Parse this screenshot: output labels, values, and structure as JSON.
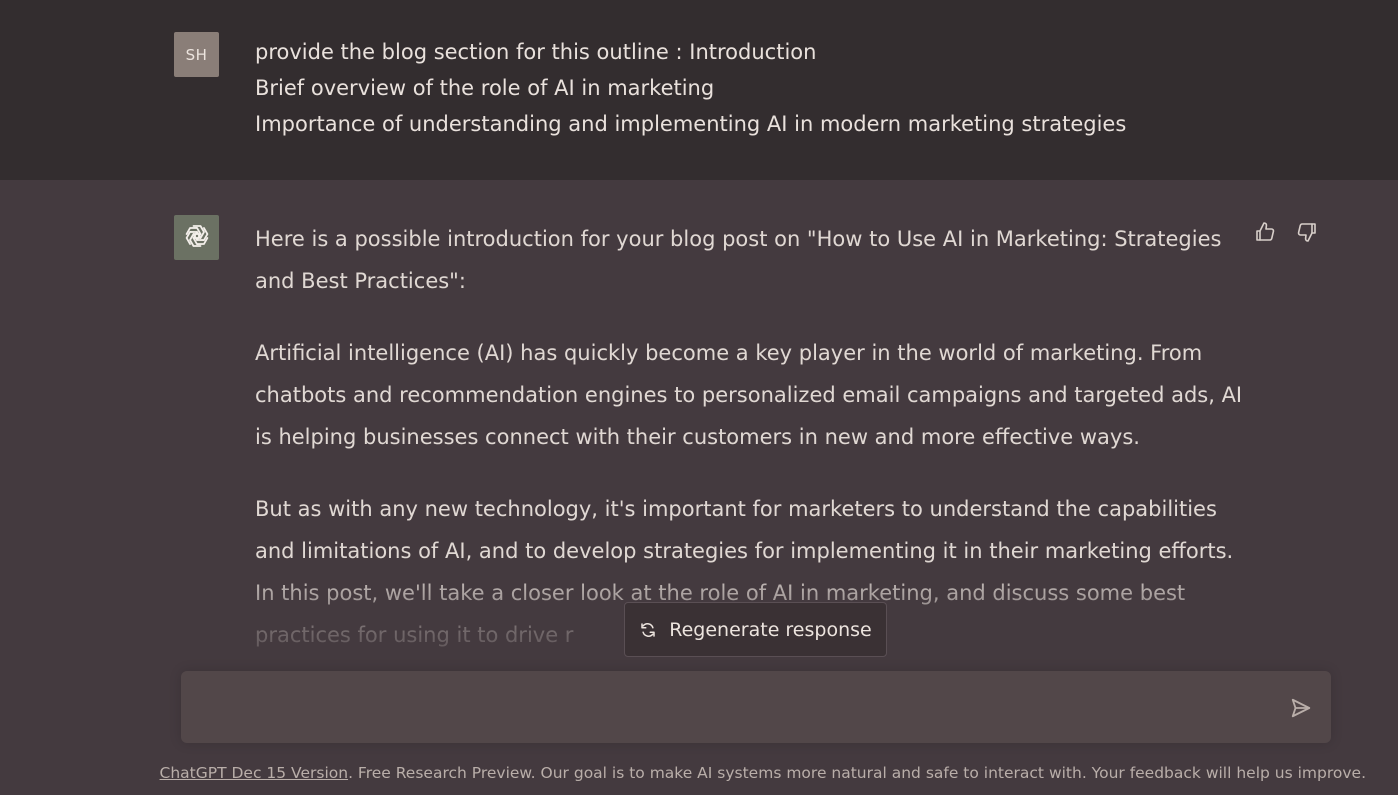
{
  "user_message": {
    "avatar_initials": "SH",
    "lines": [
      "provide the blog section for this outline : Introduction",
      "Brief overview of the role of AI in marketing",
      "Importance of understanding and implementing AI in modern marketing strategies"
    ]
  },
  "assistant_message": {
    "avatar_icon": "openai-logo-icon",
    "paragraphs": [
      "Here is a possible introduction for your blog post on \"How to Use AI in Marketing: Strategies and Best Practices\":",
      "Artificial intelligence (AI) has quickly become a key player in the world of marketing. From chatbots and recommendation engines to personalized email campaigns and targeted ads, AI is helping businesses connect with their customers in new and more effective ways.",
      "But as with any new technology, it's important for marketers to understand the capabilities and limitations of AI, and to develop strategies for implementing it in their marketing efforts. In this post, we'll take a closer look at the role of AI in marketing, and discuss some best practices for using it to drive r"
    ],
    "feedback_icons": [
      "thumbs-up-icon",
      "thumbs-down-icon"
    ]
  },
  "regenerate": {
    "label": "Regenerate response",
    "icon": "refresh-icon"
  },
  "input": {
    "value": "",
    "placeholder": "",
    "send_icon": "send-icon"
  },
  "footer": {
    "link_text": "ChatGPT Dec 15 Version",
    "text": ". Free Research Preview. Our goal is to make AI systems more natural and safe to interact with. Your feedback will help us improve."
  },
  "colors": {
    "user_block_bg": "#332D2F",
    "assistant_bg": "#443A3F",
    "user_avatar_bg": "#8A7E78",
    "assistant_avatar_bg": "#6B7163",
    "text": "#E9E1DC"
  }
}
